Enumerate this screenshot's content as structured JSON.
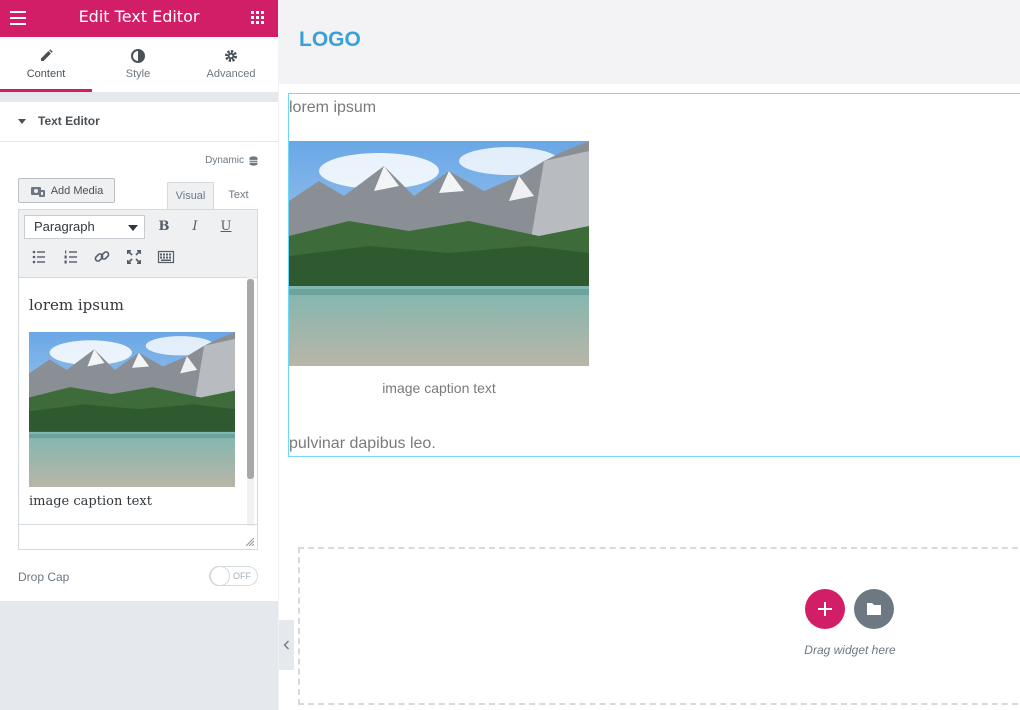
{
  "panel": {
    "title": "Edit Text Editor",
    "tabs": [
      {
        "label": "Content",
        "icon": "pencil-icon",
        "active": true
      },
      {
        "label": "Style",
        "icon": "half-circle-icon",
        "active": false
      },
      {
        "label": "Advanced",
        "icon": "gear-icon",
        "active": false
      }
    ],
    "section_title": "Text Editor",
    "dynamic_label": "Dynamic",
    "add_media_label": "Add Media",
    "editor_tabs": {
      "visual": "Visual",
      "text": "Text"
    },
    "format_select": "Paragraph",
    "editor_content": {
      "paragraph": "lorem ipsum",
      "caption": "image caption text"
    },
    "drop_cap_label": "Drop Cap",
    "drop_cap_toggle": "OFF"
  },
  "canvas": {
    "logo": "LOGO",
    "paragraph": "lorem ipsum",
    "caption": "image caption text",
    "closing_text": "pulvinar dapibus leo.",
    "drag_hint": "Drag widget here"
  },
  "colors": {
    "accent": "#d21e66",
    "logo": "#3aa0d8",
    "selection": "#71d7f7"
  }
}
